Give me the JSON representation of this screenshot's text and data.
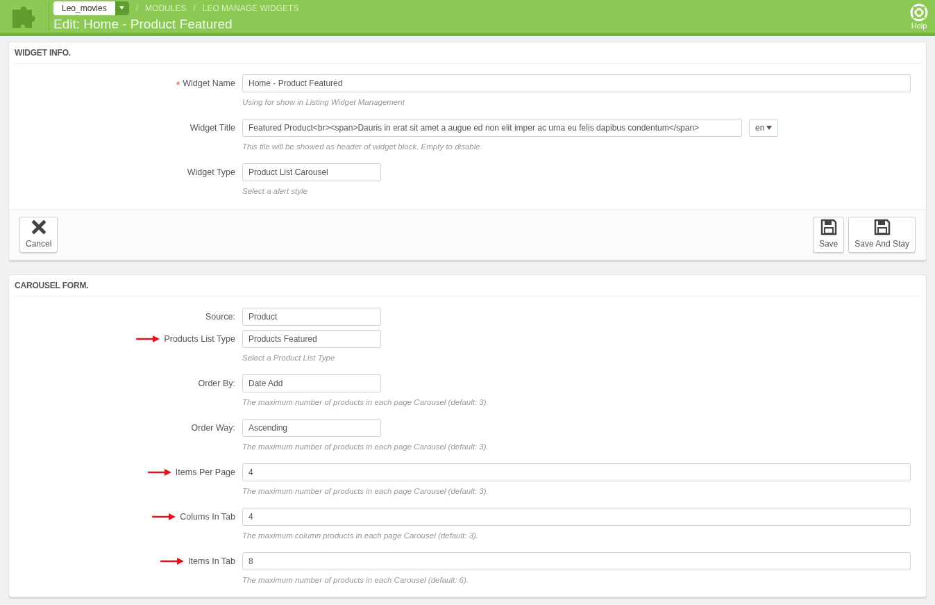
{
  "header": {
    "shop_selector": "Leo_movies",
    "breadcrumbs": [
      {
        "separator": "/",
        "label": "MODULES"
      },
      {
        "separator": "/",
        "label": "LEO MANAGE WIDGETS"
      }
    ],
    "title": "Edit: Home - Product Featured",
    "help_label": "Help"
  },
  "panels": [
    {
      "title": "WIDGET INFO.",
      "fields": [
        {
          "label": "Widget Name",
          "required_mark": "*",
          "arrow": false,
          "kind": "wide",
          "value": "Home - Product Featured",
          "help": "Using for show in Listing Widget Management"
        },
        {
          "label": "Widget Title",
          "arrow": false,
          "kind": "title",
          "value": "Featured Product<br><span>Dauris in erat sit amet a augue ed non elit imper ac urna eu felis dapibus condentum</span>",
          "language": "en",
          "help": "This tile will be showed as header of widget block. Empty to disable"
        },
        {
          "label": "Widget Type",
          "arrow": false,
          "kind": "short",
          "value": "Product List Carousel",
          "help": "Select a alert style"
        }
      ],
      "footer": {
        "left": [
          {
            "kind": "cancel",
            "label": "Cancel"
          }
        ],
        "right": [
          {
            "kind": "save",
            "label": "Save"
          },
          {
            "kind": "save",
            "label": "Save And Stay"
          }
        ]
      }
    },
    {
      "title": "CAROUSEL FORM.",
      "fields": [
        {
          "label": "Source:",
          "arrow": false,
          "kind": "short",
          "value": "Product"
        },
        {
          "label": "Products List Type",
          "arrow": true,
          "kind": "short",
          "value": "Products Featured",
          "help": "Select a Product List Type"
        },
        {
          "label": "Order By:",
          "arrow": false,
          "kind": "short",
          "value": "Date Add",
          "help": "The maximum number of products in each page Carousel (default: 3)."
        },
        {
          "label": "Order Way:",
          "arrow": false,
          "kind": "short",
          "value": "Ascending",
          "help": "The maximum number of products in each page Carousel (default: 3)."
        },
        {
          "label": "Items Per Page",
          "arrow": true,
          "kind": "wide",
          "value": "4",
          "help": "The maximum number of products in each page Carousel (default: 3)."
        },
        {
          "label": "Colums In Tab",
          "arrow": true,
          "kind": "wide",
          "value": "4",
          "help": "The maximum column products in each page Carousel (default: 3)."
        },
        {
          "label": "Items In Tab",
          "arrow": true,
          "kind": "wide",
          "value": "8",
          "help": "The maximum number of products in each Carousel (default: 6)."
        }
      ]
    }
  ]
}
